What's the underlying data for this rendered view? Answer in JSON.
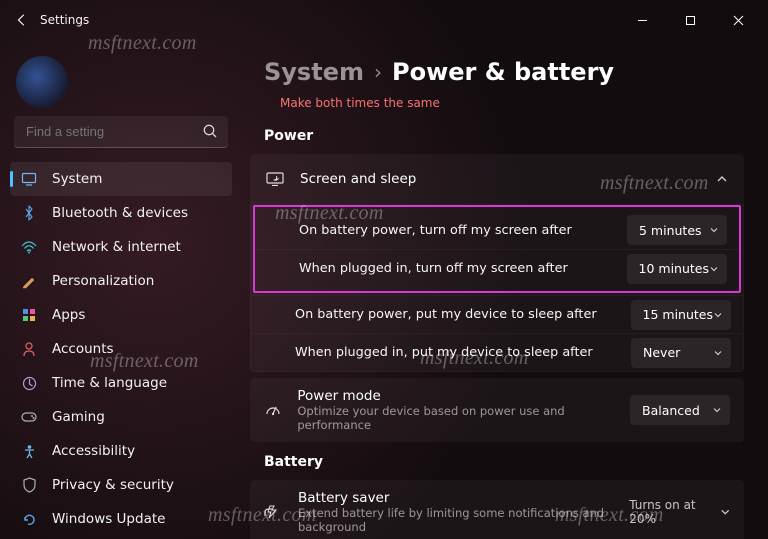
{
  "window": {
    "title": "Settings"
  },
  "search": {
    "placeholder": "Find a setting"
  },
  "sidebar": {
    "items": [
      {
        "label": "System"
      },
      {
        "label": "Bluetooth & devices"
      },
      {
        "label": "Network & internet"
      },
      {
        "label": "Personalization"
      },
      {
        "label": "Apps"
      },
      {
        "label": "Accounts"
      },
      {
        "label": "Time & language"
      },
      {
        "label": "Gaming"
      },
      {
        "label": "Accessibility"
      },
      {
        "label": "Privacy & security"
      },
      {
        "label": "Windows Update"
      }
    ]
  },
  "breadcrumb": {
    "parent": "System",
    "sep": "›",
    "current": "Power & battery"
  },
  "cutoff_text": "Make both times the same",
  "power": {
    "heading": "Power",
    "screen_sleep": {
      "title": "Screen and sleep",
      "rows": [
        {
          "label": "On battery power, turn off my screen after",
          "value": "5 minutes"
        },
        {
          "label": "When plugged in, turn off my screen after",
          "value": "10 minutes"
        },
        {
          "label": "On battery power, put my device to sleep after",
          "value": "15 minutes"
        },
        {
          "label": "When plugged in, put my device to sleep after",
          "value": "Never"
        }
      ]
    },
    "power_mode": {
      "title": "Power mode",
      "subtitle": "Optimize your device based on power use and performance",
      "value": "Balanced"
    }
  },
  "battery": {
    "heading": "Battery",
    "saver": {
      "title": "Battery saver",
      "subtitle": "Extend battery life by limiting some notifications and background",
      "status": "Turns on at 20%"
    }
  },
  "watermark": "msftnext.com"
}
